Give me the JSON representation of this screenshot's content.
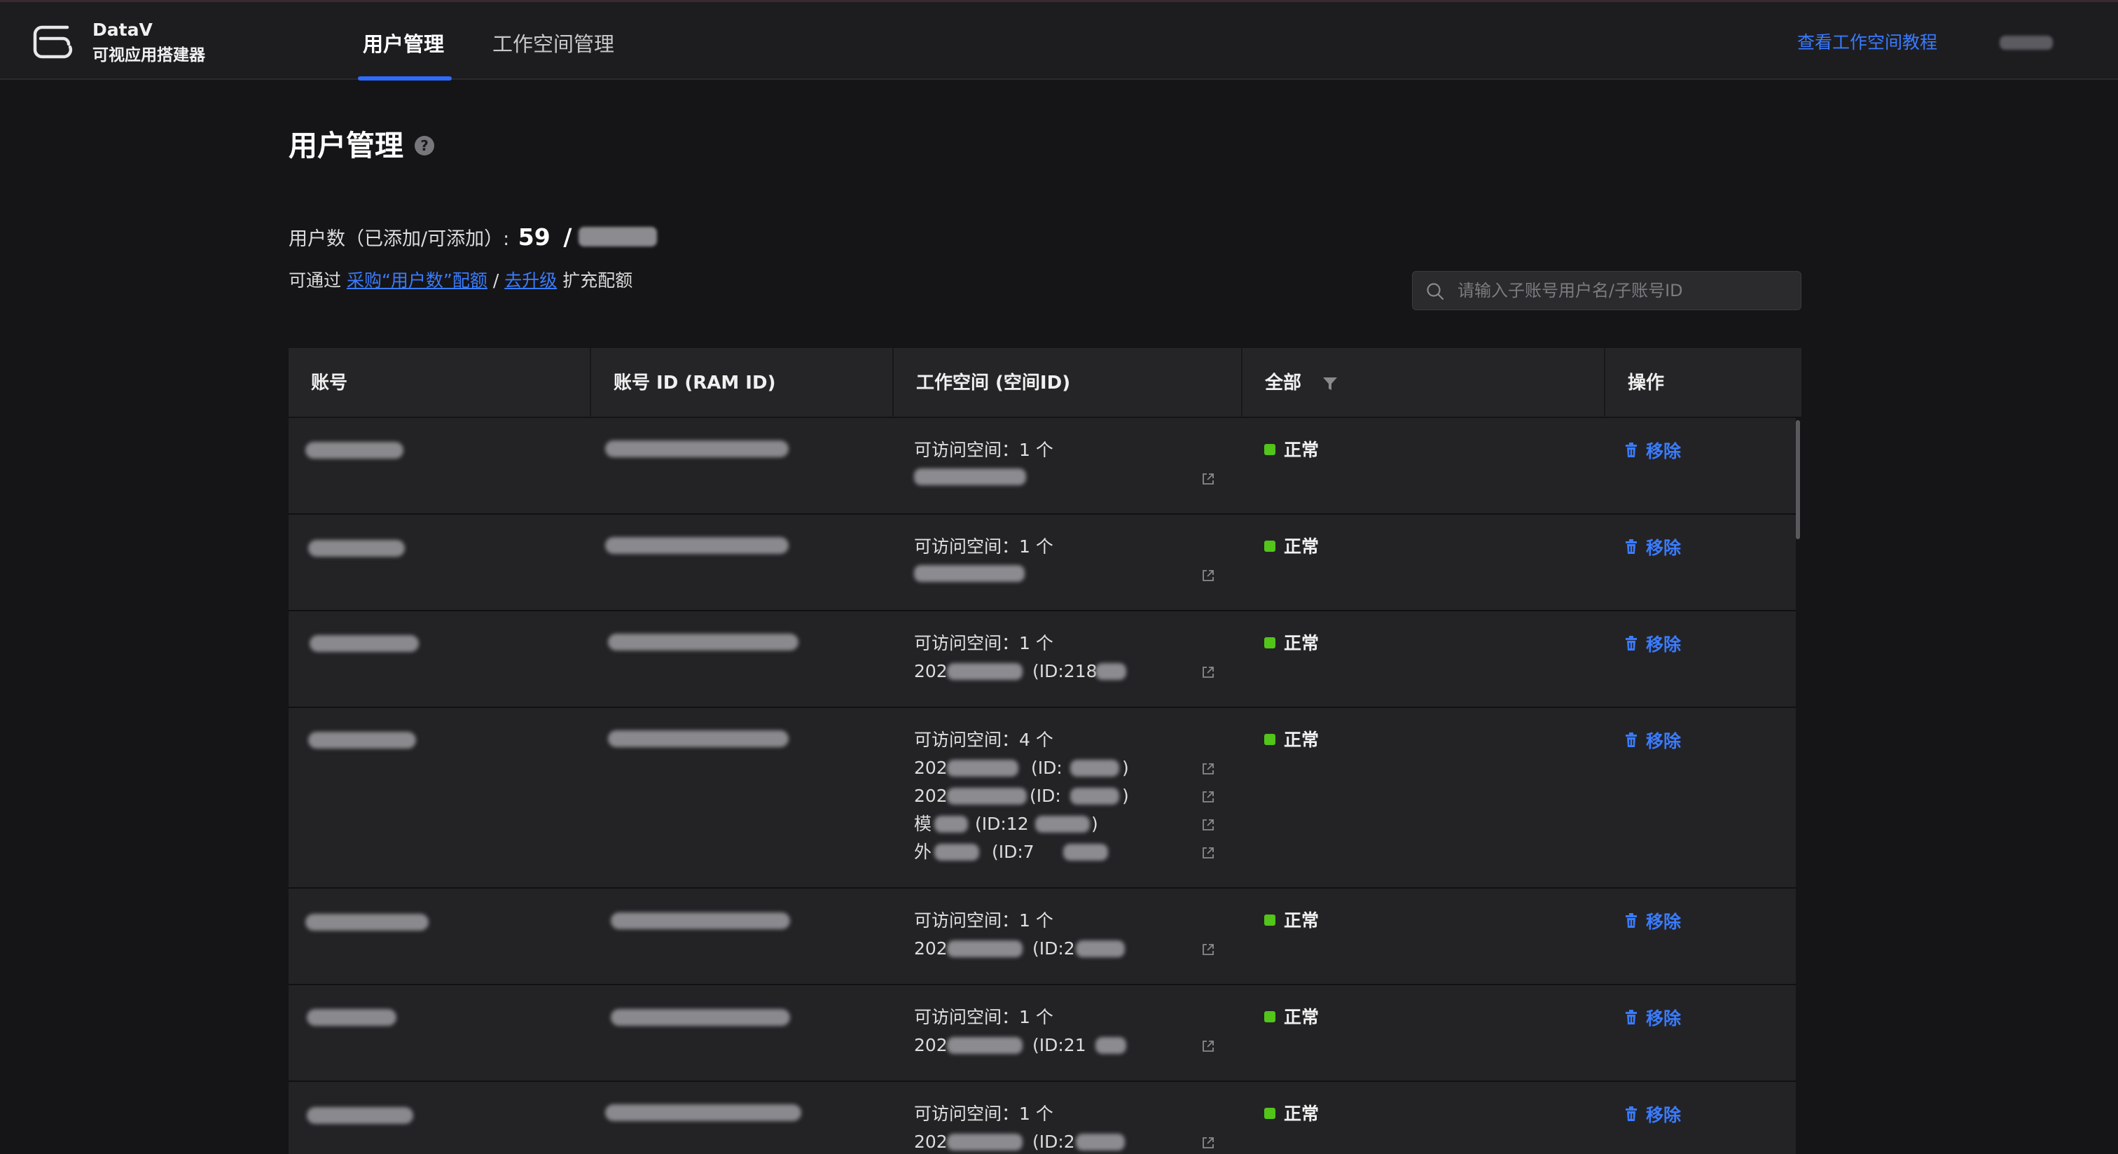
{
  "app": {
    "name": "DataV",
    "subtitle": "可视应用搭建器"
  },
  "nav": {
    "tabs": [
      {
        "label": "用户管理",
        "active": true
      },
      {
        "label": "工作空间管理",
        "active": false
      }
    ],
    "tutorial_link": "查看工作空间教程"
  },
  "page": {
    "title": "用户管理",
    "help_icon": "?"
  },
  "quota": {
    "label": "用户数（已添加/可添加）:",
    "added": "59",
    "separator": "/",
    "help_prefix": "可通过",
    "purchase_link": "采购“用户数”配额",
    "divider": "/",
    "upgrade_link": "去升级",
    "help_suffix": "扩充配额"
  },
  "search": {
    "placeholder": "请输入子账号用户名/子账号ID",
    "value": ""
  },
  "table": {
    "columns": {
      "account": "账号",
      "ram_id": "账号 ID (RAM ID)",
      "workspace": "工作空间 (空间ID)",
      "status": "全部",
      "actions": "操作"
    },
    "rows": [
      {
        "workspace_title": "可访问空间：1 个",
        "workspaces": [
          ""
        ],
        "status": "正常",
        "action": "移除"
      },
      {
        "workspace_title": "可访问空间：1 个",
        "workspaces": [
          ""
        ],
        "status": "正常",
        "action": "移除"
      },
      {
        "workspace_title": "可访问空间：1 个",
        "workspaces": [
          "202",
          "(ID:218"
        ],
        "status": "正常",
        "action": "移除"
      },
      {
        "workspace_title": "可访问空间：4 个",
        "workspaces": [
          "202",
          "(ID:",
          ")",
          "202",
          "(ID:",
          ")",
          "模",
          "(ID:12",
          ")",
          "外",
          "(ID:7"
        ],
        "status": "正常",
        "action": "移除"
      },
      {
        "workspace_title": "可访问空间：1 个",
        "workspaces": [
          "202",
          "(ID:2"
        ],
        "status": "正常",
        "action": "移除"
      },
      {
        "workspace_title": "可访问空间：1 个",
        "workspaces": [
          "202",
          "(ID:21"
        ],
        "status": "正常",
        "action": "移除"
      },
      {
        "workspace_title": "可访问空间：1 个",
        "workspaces": [
          "202",
          "(ID:2"
        ],
        "status": "正常",
        "action": "移除"
      }
    ]
  },
  "colors": {
    "accent": "#3a7bff",
    "status_ok": "#52c41a",
    "background": "#151517",
    "row_bg": "#232326",
    "header_bg": "#252528"
  },
  "icons": {
    "logo": "datav-logo-icon",
    "help": "question-circle-icon",
    "search": "search-icon",
    "filter": "filter-icon",
    "external": "external-link-icon",
    "trash": "trash-icon"
  }
}
